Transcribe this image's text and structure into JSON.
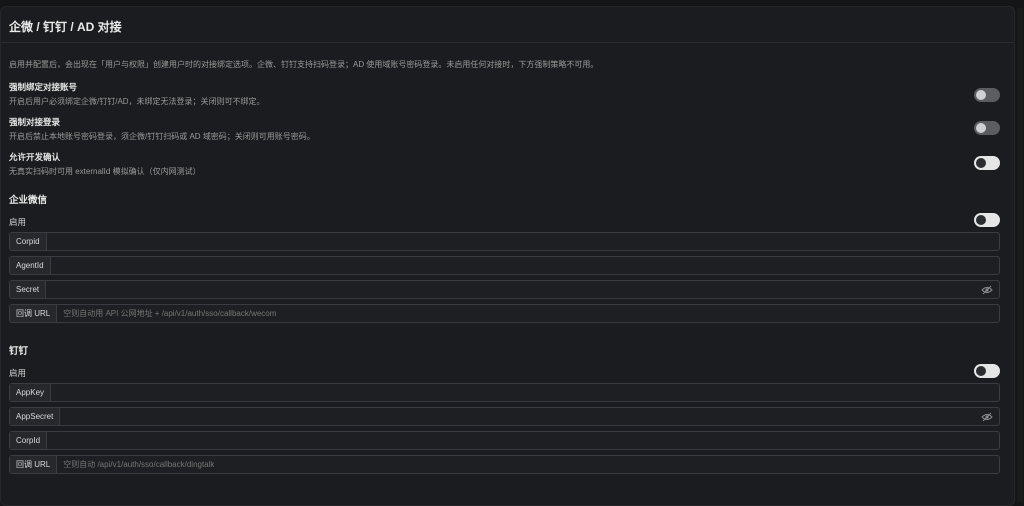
{
  "header": {
    "title": "企微 / 钉钉 / AD 对接"
  },
  "description": "启用并配置后，会出现在「用户与权限」创建用户时的对接绑定选项。企微、钉钉支持扫码登录；AD 使用域账号密码登录。未启用任何对接时，下方强制策略不可用。",
  "settings": [
    {
      "title": "强制绑定对接账号",
      "subtitle": "开启后用户必须绑定企微/钉钉/AD，未绑定无法登录；关闭则可不绑定。",
      "enabled": false
    },
    {
      "title": "强制对接登录",
      "subtitle": "开启后禁止本地账号密码登录，须企微/钉钉扫码或 AD 域密码；关闭则可用账号密码。",
      "enabled": false
    },
    {
      "title": "允许开发确认",
      "subtitle": "无真实扫码时可用 externalId 模拟确认（仅内网测试）",
      "enabled": true
    }
  ],
  "wecom": {
    "title": "企业微信",
    "enable_label": "启用",
    "enabled": true,
    "fields": {
      "corpid_label": "Corpid",
      "agentid_label": "AgentId",
      "secret_label": "Secret",
      "callback_label": "回调 URL",
      "callback_placeholder": "空则自动用 API 公网地址 + /api/v1/auth/sso/callback/wecom"
    }
  },
  "dingtalk": {
    "title": "钉钉",
    "enable_label": "启用",
    "enabled": true,
    "fields": {
      "appkey_label": "AppKey",
      "appsecret_label": "AppSecret",
      "corpid_label": "CorpId",
      "callback_label": "回调 URL",
      "callback_placeholder": "空则自动 /api/v1/auth/sso/callback/dingtalk"
    }
  },
  "icons": {
    "password_toggle": "eye-off-icon"
  },
  "colors": {
    "background": "#141517",
    "card": "#1b1c1f",
    "toggle_on": "#e6e6e6",
    "toggle_off": "#5b5d61"
  }
}
